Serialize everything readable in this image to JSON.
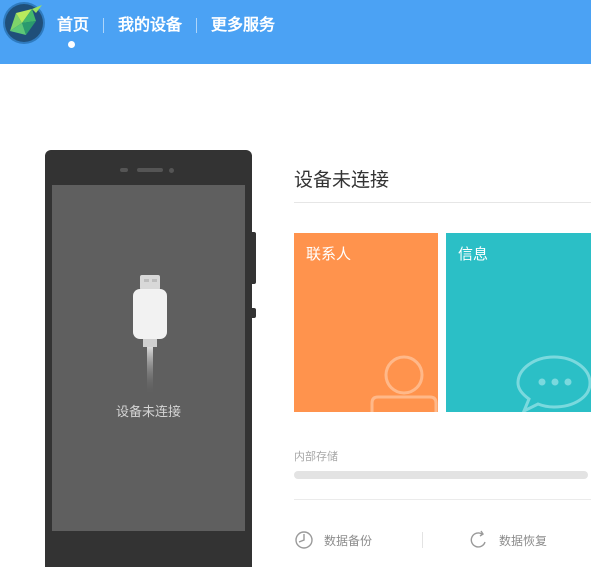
{
  "header": {
    "logo_icon": "hummingbird-logo-icon",
    "tabs": [
      {
        "label": "首页",
        "active": true
      },
      {
        "label": "我的设备",
        "active": false
      },
      {
        "label": "更多服务",
        "active": false
      }
    ],
    "colors": {
      "bar": "#4ba2f4",
      "text": "#ffffff"
    }
  },
  "phone": {
    "status_text": "设备未连接",
    "cable_icon": "usb-cable-icon"
  },
  "device": {
    "title": "设备未连接"
  },
  "tiles": [
    {
      "label": "联系人",
      "icon": "contact-person-icon",
      "color": "#ff934d"
    },
    {
      "label": "信息",
      "icon": "chat-bubble-icon",
      "color": "#2bbfc6"
    }
  ],
  "storage": {
    "label": "内部存储",
    "used_fraction": 0
  },
  "actions": [
    {
      "label": "数据备份",
      "icon": "backup-clock-icon"
    },
    {
      "label": "数据恢复",
      "icon": "restore-refresh-icon"
    }
  ]
}
